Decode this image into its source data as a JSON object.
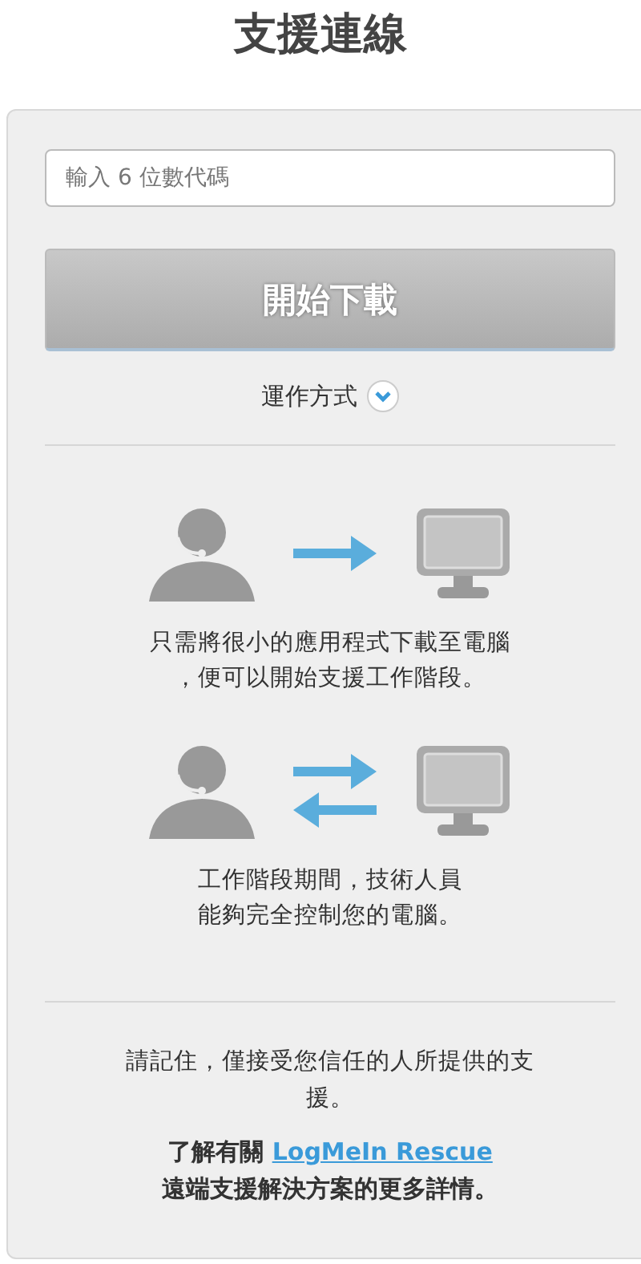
{
  "title": "支援連線",
  "code_field": {
    "placeholder": "輸入 6 位數代碼"
  },
  "download_button": {
    "label": "開始下載",
    "disabled": true
  },
  "how_it_works": {
    "label": "運作方式",
    "expanded": false
  },
  "steps": [
    {
      "kind": "one-way",
      "text": "只需將很小的應用程式下載至電腦，便可以開始支援工作階段。"
    },
    {
      "kind": "two-way",
      "text": "工作階段期間，技術人員能夠完全控制您的電腦。"
    }
  ],
  "notice": "請記住，僅接受您信任的人所提供的支援。",
  "learn_more": {
    "before": "了解有關 ",
    "link": "LogMeIn Rescue",
    "after": "遠端支援解決方案的更多詳情。"
  }
}
